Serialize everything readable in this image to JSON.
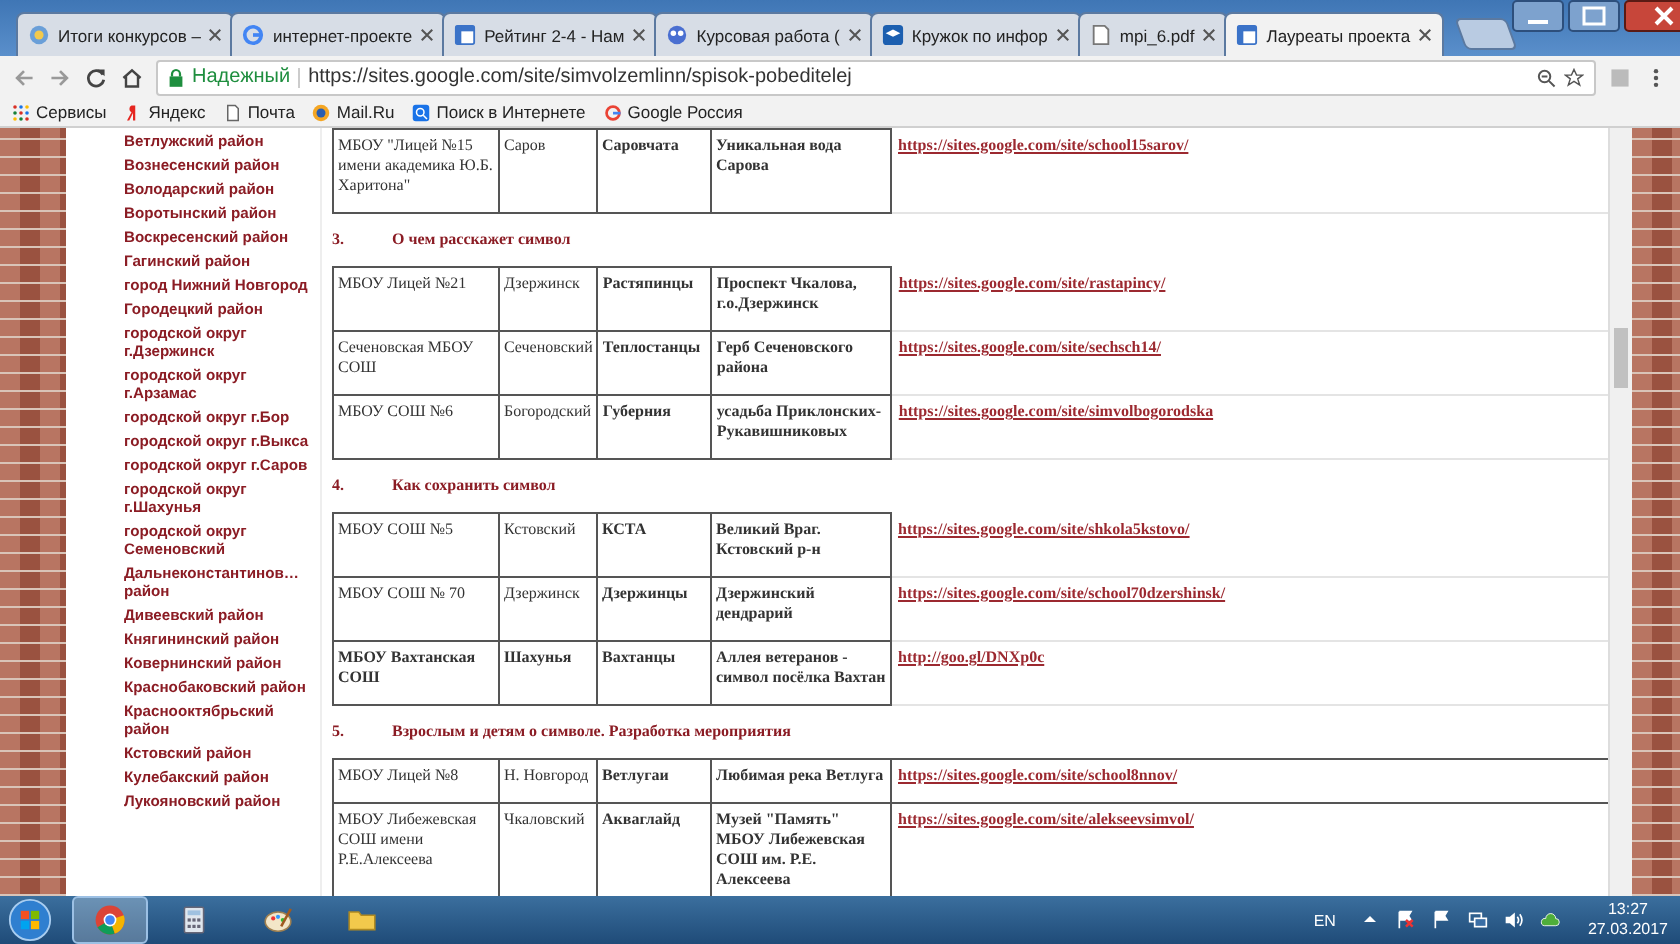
{
  "tabs": [
    {
      "title": "Итоги конкурсов –",
      "selected": false
    },
    {
      "title": "интернет-проекте",
      "selected": false
    },
    {
      "title": "Рейтинг 2-4 - Нам",
      "selected": false
    },
    {
      "title": "Курсовая работа (",
      "selected": false
    },
    {
      "title": "Кружок по инфор",
      "selected": false
    },
    {
      "title": "mpi_6.pdf",
      "selected": false
    },
    {
      "title": "Лауреаты проекта",
      "selected": true
    }
  ],
  "address": {
    "secure_label": "Надежный",
    "url": "https://sites.google.com/site/simvolzemlinn/spisok-pobeditelej"
  },
  "bookmarks": [
    {
      "label": "Сервисы"
    },
    {
      "label": "Яндекс"
    },
    {
      "label": "Почта"
    },
    {
      "label": "Mail.Ru"
    },
    {
      "label": "Поиск в Интернете"
    },
    {
      "label": "Google Россия"
    }
  ],
  "sidebar": {
    "items": [
      "Ветлужский район",
      "Вознесенский район",
      "Володарский район",
      "Воротынский район",
      "Воскресенский район",
      "Гагинский район",
      "город Нижний Новгород",
      "Городецкий район",
      "городской округ г.Дзержинск",
      "городской округ г.Арзамас",
      "городской округ  г.Бор",
      "городской округ г.Выкса",
      "городской округ г.Саров",
      "городской округ г.Шахунья",
      "городской округ Семеновский",
      "Дальнеконстантинов… район",
      "Дивеевский район",
      "Княгининский район",
      "Ковернинский район",
      "Краснобаковский район",
      "Краснооктябрьский район",
      "Кстовский район",
      "Кулебакский район",
      "Лукояновский район"
    ]
  },
  "sections": [
    {
      "framed_links": false,
      "rows": [
        {
          "cells": [
            "МБОУ \"Лицей №15 имени академика Ю.Б. Харитона\"",
            "Саров",
            "Саровчата",
            "Уникальная вода Сарова"
          ],
          "link": "https://sites.google.com/site/school15sarov/",
          "emphasis": false
        }
      ]
    },
    {
      "number": "3.",
      "title": "О чем расскажет символ",
      "framed_links": false,
      "rows": [
        {
          "cells": [
            "МБОУ Лицей №21",
            "Дзержинск",
            "Растяпинцы",
            "Проспект Чкалова, г.о.Дзержинск"
          ],
          "link": "https://sites.google.com/site/rastapincy/",
          "emphasis": false
        },
        {
          "cells": [
            "Сеченовская МБОУ СОШ",
            "Сеченовский",
            "Теплостанцы",
            "Герб Сеченовского района"
          ],
          "link": "https://sites.google.com/site/sechsch14/",
          "emphasis": false
        },
        {
          "cells": [
            "МБОУ СОШ №6",
            "Богородский",
            "Губерния",
            "усадьба Приклонских-Рукавишниковых"
          ],
          "link": "https://sites.google.com/site/simvolbogorodska",
          "emphasis": false
        }
      ]
    },
    {
      "number": "4.",
      "title": "Как сохранить символ",
      "framed_links": false,
      "rows": [
        {
          "cells": [
            "МБОУ СОШ №5",
            "Кстовский",
            "КСТА",
            "Великий Враг. Кстовский р-н"
          ],
          "link": "https://sites.google.com/site/shkola5kstovo/",
          "emphasis": false
        },
        {
          "cells": [
            "МБОУ СОШ № 70",
            "Дзержинск",
            "Дзержинцы",
            "Дзержинский дендрарий"
          ],
          "link": "https://sites.google.com/site/school70dzershinsk/",
          "emphasis": false
        },
        {
          "cells": [
            "МБОУ Вахтанская СОШ",
            "Шахунья",
            "Вахтанцы",
            "Аллея ветеранов - символ посёлка Вахтан"
          ],
          "link": "http://goo.gl/DNXp0c",
          "emphasis": true
        }
      ]
    },
    {
      "number": "5.",
      "title": "Взрослым и детям о символе. Разработка мероприятия",
      "framed_links": true,
      "rows": [
        {
          "cells": [
            "МБОУ Лицей №8",
            "Н. Новгород",
            "Ветлугаи",
            "Любимая река Ветлуга"
          ],
          "link": "https://sites.google.com/site/school8nnov/",
          "emphasis": false
        },
        {
          "cells": [
            "МБОУ Либежевская СОШ имени Р.Е.Алексеева",
            "Чкаловский",
            "Акваглайд",
            "Музей \"Память\" МБОУ Либежевская СОШ им. Р.Е. Алексеева"
          ],
          "link": "https://sites.google.com/site/alekseevsimvol/",
          "emphasis": false
        }
      ]
    }
  ],
  "taskbar": {
    "apps": [
      {
        "selected": true
      },
      {
        "selected": false
      },
      {
        "selected": false
      },
      {
        "selected": false
      }
    ],
    "language": "EN",
    "time": "13:27",
    "date": "27.03.2017"
  }
}
